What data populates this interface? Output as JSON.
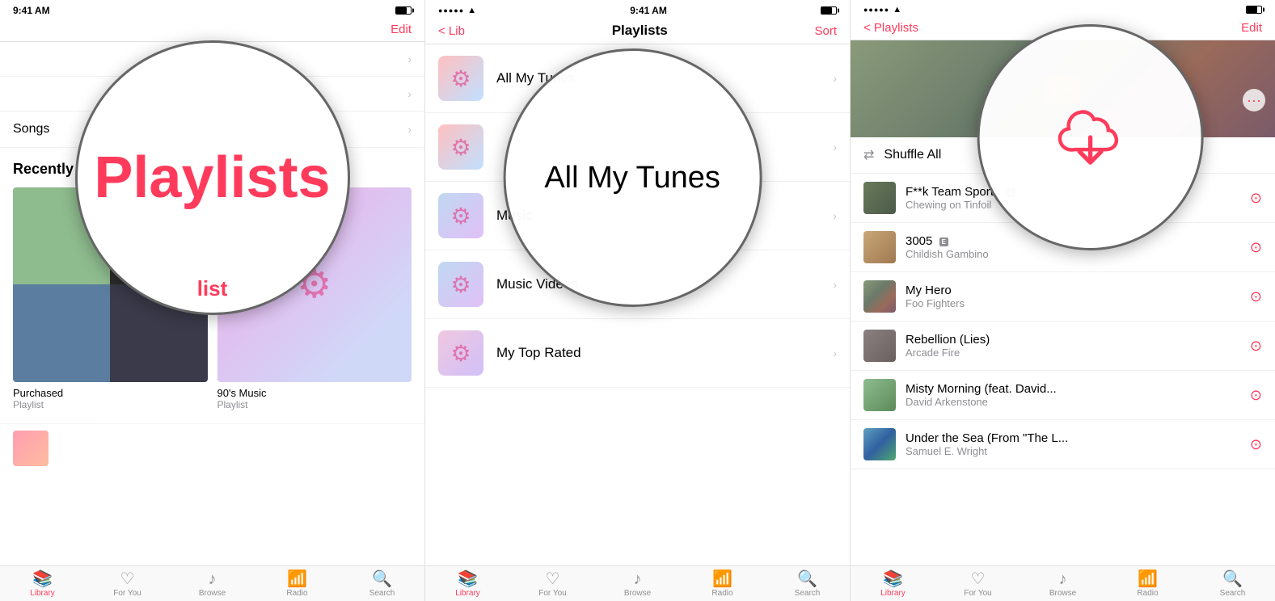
{
  "panel1": {
    "statusBar": {
      "time": "9:41 AM",
      "batteryFill": "70%"
    },
    "navBar": {
      "actionLabel": "Edit"
    },
    "magnifyText": "Playlists",
    "magnifyPartial": "list",
    "listItems": [
      {
        "label": ""
      },
      {
        "label": ""
      }
    ],
    "songsLabel": "Songs",
    "recentlyAdded": {
      "sectionTitle": "Recently Added",
      "albums": [
        {
          "name": "Purchased",
          "sub": "Playlist"
        },
        {
          "name": "90's Music",
          "sub": "Playlist"
        }
      ]
    },
    "tabBar": {
      "items": [
        {
          "icon": "📚",
          "label": "Library"
        },
        {
          "icon": "♥",
          "label": "For You"
        },
        {
          "icon": "♪",
          "label": "Browse"
        },
        {
          "icon": "📡",
          "label": "Radio"
        },
        {
          "icon": "🔍",
          "label": "Search"
        }
      ],
      "activeIndex": 0
    }
  },
  "panel2": {
    "statusBar": {
      "time": "9:41 AM"
    },
    "navBar": {
      "backLabel": "< Lib",
      "title": "Playlists",
      "sortLabel": "Sort"
    },
    "magnifyText": "All My Tunes",
    "listItems": [
      {
        "label": "All My Tunes",
        "iconClass": "gradient1"
      },
      {
        "label": "",
        "iconClass": "gradient1"
      },
      {
        "label": "Music",
        "iconClass": "gradient2"
      },
      {
        "label": "Music Videos",
        "iconClass": "gradient2"
      },
      {
        "label": "My Top Rated",
        "iconClass": "gradient3"
      }
    ],
    "tabBar": {
      "activeIndex": 0
    }
  },
  "panel3": {
    "statusBar": {
      "time": ""
    },
    "navBar": {
      "backLabel": "< Playlists",
      "editLabel": "Edit"
    },
    "headerAlbum": "My Hero Foo Fighters",
    "shuffleLabel": "Shuffle All",
    "songs": [
      {
        "title": "F**k Team Sports",
        "artist": "Chewing on Tinfoil",
        "explicit": true,
        "thumbClass": "thumb-tinfoil"
      },
      {
        "title": "3005",
        "artist": "Childish Gambino",
        "explicit": true,
        "thumbClass": "thumb-gambino"
      },
      {
        "title": "My Hero",
        "artist": "Foo Fighters",
        "explicit": false,
        "thumbClass": "thumb-foo"
      },
      {
        "title": "Rebellion (Lies)",
        "artist": "Arcade Fire",
        "explicit": false,
        "thumbClass": "thumb-arcade"
      },
      {
        "title": "Misty Morning (feat. David...",
        "artist": "David Arkenstone",
        "explicit": false,
        "thumbClass": "thumb-celtic"
      },
      {
        "title": "Under the Sea (From \"The L...",
        "artist": "Samuel E. Wright",
        "explicit": false,
        "thumbClass": "thumb-ariel"
      }
    ],
    "tabBar": {
      "activeIndex": 0
    }
  },
  "tabBarLabels": {
    "library": "Library",
    "forYou": "For You",
    "browse": "Browse",
    "radio": "Radio",
    "search": "Search"
  },
  "icons": {
    "back": "<",
    "chevron": "›",
    "shuffle": "⇄",
    "download": "↓",
    "more": "•••",
    "explicit": "E"
  }
}
